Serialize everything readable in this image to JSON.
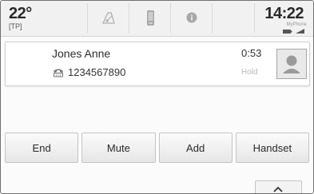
{
  "status_bar": {
    "temperature": "22°",
    "traffic_program": "[TP]",
    "time": "14:22",
    "phone_name": "MyPhone",
    "icons": [
      "music-note-icon",
      "phone-list-icon",
      "info-icon"
    ]
  },
  "call": {
    "caller_name": "Jones Anne",
    "phone_number": "1234567890",
    "number_type_icon": "landline-phone-icon",
    "duration": "0:53",
    "hold_label": "Hold",
    "avatar_icon": "person-silhouette-icon"
  },
  "actions": {
    "end_label": "End",
    "mute_label": "Mute",
    "add_label": "Add",
    "handset_label": "Handset"
  },
  "collapse_icon": "chevron-up-icon"
}
